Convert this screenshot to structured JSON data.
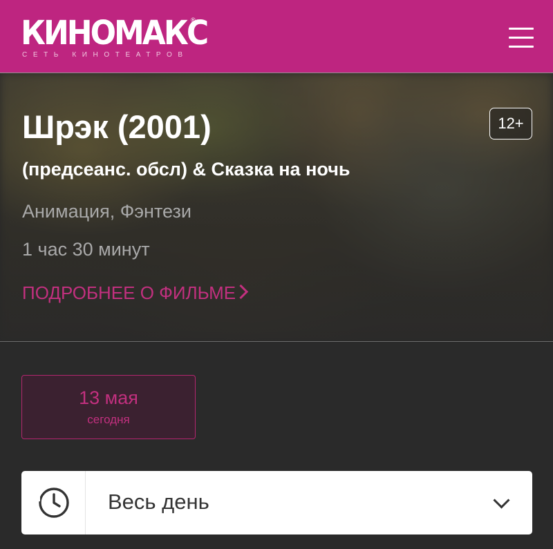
{
  "header": {
    "logo_text": "КИНОМАКС",
    "logo_subtitle": "СЕТЬ КИНОТЕАТРОВ",
    "logo_reg_mark": "®",
    "menu_icon": "hamburger-menu-icon",
    "background_color": "#be2580"
  },
  "movie": {
    "title": "Шрэк (2001)",
    "age_rating": "12+",
    "subtitle": "(предсеанс. обсл) & Сказка на ночь",
    "genre": "Анимация, Фэнтези",
    "duration": "1 час 30 минут",
    "more_link_label": "ПОДРОБНЕЕ О ФИЛЬМЕ",
    "more_link_icon": "chevron-right-icon"
  },
  "date_selector": {
    "selected_date": "13 мая",
    "selected_date_caption": "сегодня",
    "accent_color": "#c2307f"
  },
  "time_filter": {
    "icon": "clock-icon",
    "selected_value": "Весь день",
    "dropdown_icon": "chevron-down-icon"
  }
}
